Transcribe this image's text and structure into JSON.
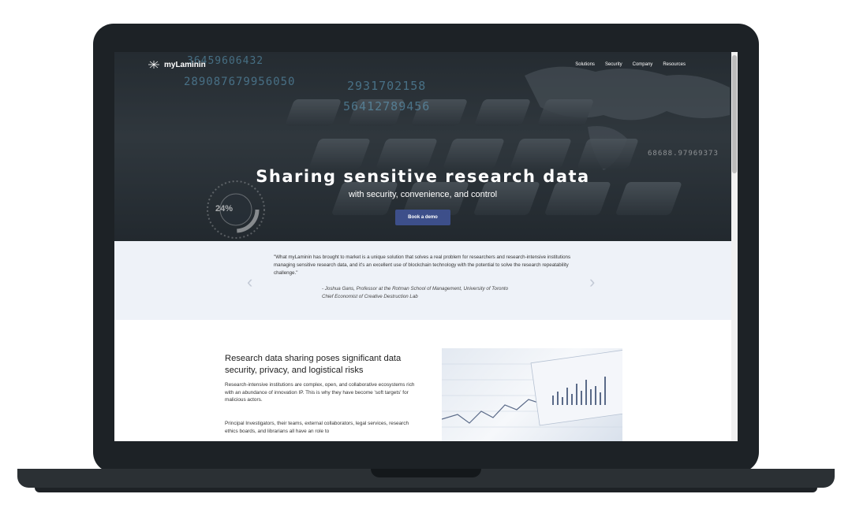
{
  "brand": {
    "name": "myLaminin"
  },
  "nav": {
    "items": [
      "Solutions",
      "Security",
      "Company",
      "Resources"
    ]
  },
  "hero": {
    "title": "Sharing sensitive research data",
    "subtitle": "with security, convenience, and control",
    "cta_label": "Book a demo",
    "gauge_value": "24%",
    "numbers": [
      "2931702158",
      "56412789456",
      "36459606432",
      "289087679956050",
      "68688.97969373"
    ]
  },
  "testimonial": {
    "quote": "\"What myLaminin has brought to market is a unique solution that solves a real problem for researchers and research-intensive institutions managing sensitive research data, and it's an excellent use of blockchain technology with the potential to solve the research repeatability challenge.\"",
    "author_line": "- Joshua Gans, Professor at the Rotman School of Management, University of Toronto",
    "author_role": "Chief Economist of Creative Destruction Lab"
  },
  "content": {
    "heading": "Research data sharing poses significant data security, privacy, and logistical risks",
    "paragraph1": "Research-intensive institutions are complex, open, and collaborative ecosystems rich with an abundance of innovation IP. This is why they have become 'soft targets' for malicious actors.",
    "paragraph2": "Principal Investigators, their teams, external collaborators, legal services, research ethics boards, and librarians all have an role to"
  },
  "colors": {
    "accent": "#3d4f8a",
    "quote_band": "#eef2f8",
    "laptop_frame": "#1d2226"
  }
}
